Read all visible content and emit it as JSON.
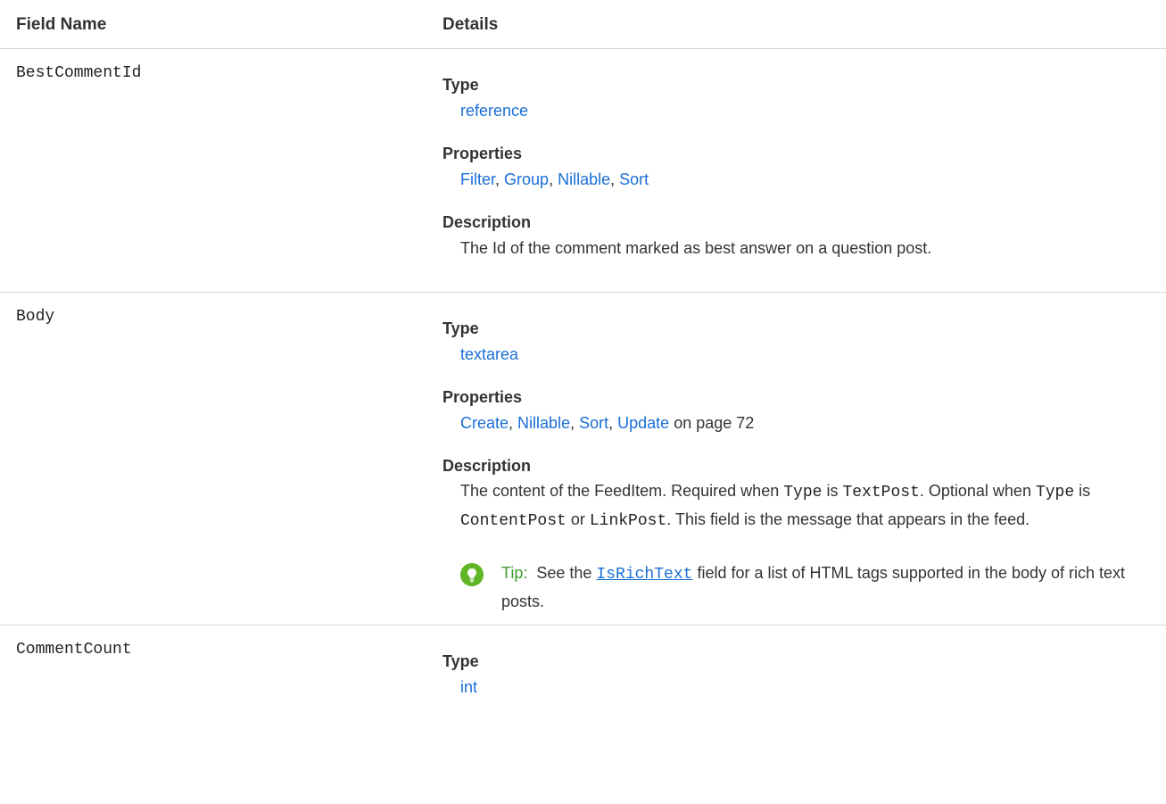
{
  "header": {
    "field_name": "Field Name",
    "details": "Details"
  },
  "labels": {
    "type": "Type",
    "properties": "Properties",
    "description": "Description"
  },
  "fields": [
    {
      "name": "BestCommentId",
      "type": "reference",
      "properties": [
        "Filter",
        "Group",
        "Nillable",
        "Sort"
      ],
      "description": "The Id of the comment marked as best answer on a question post."
    },
    {
      "name": "Body",
      "type": "textarea",
      "properties": [
        "Create",
        "Nillable",
        "Sort",
        "Update"
      ],
      "properties_suffix": "on page 72",
      "description": {
        "p1": "The content of the FeedItem. Required when ",
        "c1": "Type",
        "p2": " is ",
        "c2": "TextPost",
        "p3": ". Optional when ",
        "c3": "Type",
        "p4": " is ",
        "c4": "ContentPost",
        "p5": " or ",
        "c5": "LinkPost",
        "p6": ". This field is the message that appears in the feed."
      },
      "tip": {
        "label": "Tip:",
        "pre": "See the ",
        "link": "IsRichText",
        "post": " field for a list of HTML tags supported in the body of rich text posts."
      }
    },
    {
      "name": "CommentCount",
      "type": "int"
    }
  ],
  "colors": {
    "link": "#1a6fd6",
    "tip_icon": "#5fb526",
    "tip_label": "#3e9e2e",
    "divider": "#d4d4d4"
  },
  "icons": {
    "tip": "lightbulb-icon"
  }
}
